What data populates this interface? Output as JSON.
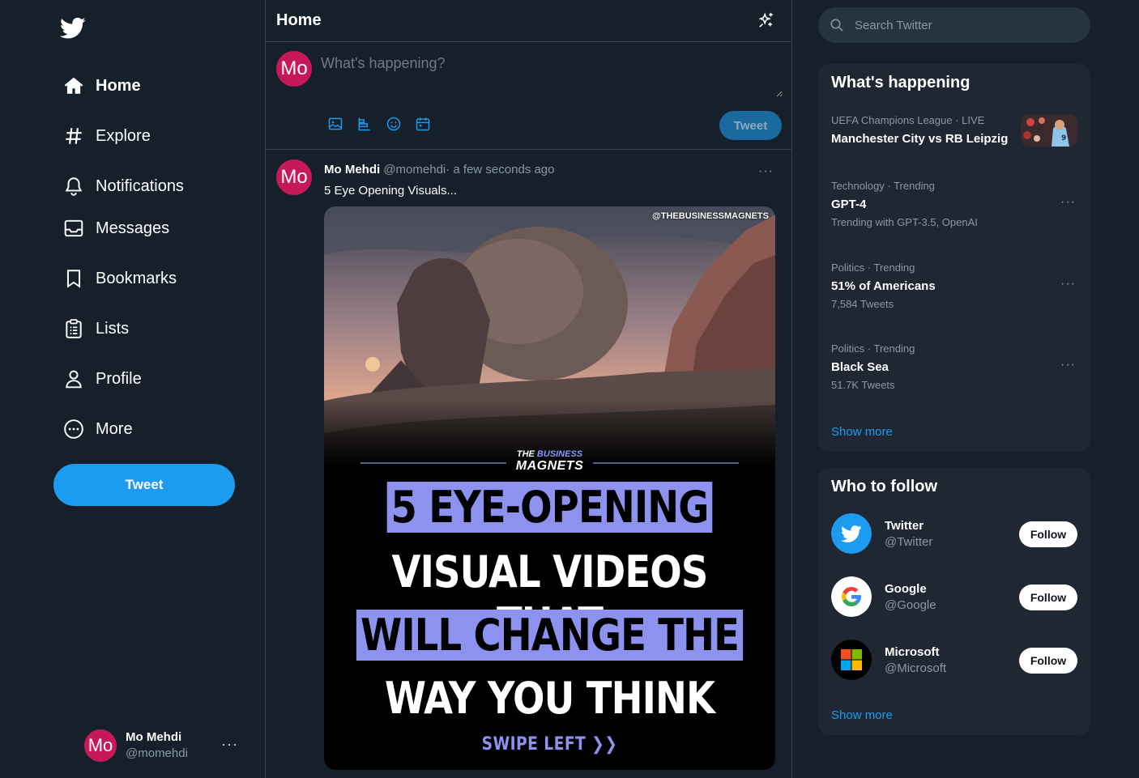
{
  "sidebar": {
    "logo_icon": "twitter-bird-icon",
    "items": [
      {
        "label": "Home",
        "icon": "home-icon"
      },
      {
        "label": "Explore",
        "icon": "hashtag-icon"
      },
      {
        "label": "Notifications",
        "icon": "bell-icon"
      },
      {
        "label": "Messages",
        "icon": "envelope-icon"
      },
      {
        "label": "Bookmarks",
        "icon": "bookmark-icon"
      },
      {
        "label": "Lists",
        "icon": "list-icon"
      },
      {
        "label": "Profile",
        "icon": "person-icon"
      },
      {
        "label": "More",
        "icon": "more-circle-icon"
      }
    ],
    "tweet_button": "Tweet",
    "account": {
      "avatar": "Mo",
      "name": "Mo Mehdi",
      "handle": "@momehdi",
      "more": "···"
    }
  },
  "main": {
    "title": "Home",
    "composer": {
      "avatar": "Mo",
      "placeholder": "What's happening?",
      "tweet_button": "Tweet"
    },
    "tweet": {
      "avatar": "Mo",
      "name": "Mo Mehdi",
      "handle": "@momehdi",
      "time": "· a few seconds ago",
      "text": "5 Eye Opening Visuals...",
      "more": "···",
      "media": {
        "watermark": "@THEBUSINESSMAGNETS",
        "brand_top_1": "THE ",
        "brand_top_2": "BUSINESS",
        "brand_bottom": "MAGNETS",
        "line1": "5 EYE-OPENING",
        "line2": "VISUAL VIDEOS THAT",
        "line3": "WILL CHANGE THE",
        "line4": "WAY YOU THINK",
        "swipe": "SWIPE LEFT ❯❯"
      }
    }
  },
  "right": {
    "search_placeholder": "Search Twitter",
    "happening": {
      "title": "What's happening",
      "trends": [
        {
          "category": "UEFA Champions League · LIVE",
          "title": "Manchester City vs RB Leipzig",
          "sub": ""
        },
        {
          "category": "Technology · Trending",
          "title": "GPT-4",
          "sub": "Trending with GPT-3.5, OpenAI"
        },
        {
          "category": "Politics · Trending",
          "title": "51% of Americans",
          "sub": "7,584 Tweets"
        },
        {
          "category": "Politics · Trending",
          "title": "Black Sea",
          "sub": "51.7K Tweets"
        }
      ],
      "show_more": "Show more"
    },
    "who_to_follow": {
      "title": "Who to follow",
      "accounts": [
        {
          "name": "Twitter",
          "handle": "@Twitter",
          "button": "Follow"
        },
        {
          "name": "Google",
          "handle": "@Google",
          "button": "Follow"
        },
        {
          "name": "Microsoft",
          "handle": "@Microsoft",
          "button": "Follow"
        }
      ],
      "show_more": "Show more"
    }
  },
  "colors": {
    "background": "#15202b",
    "accent": "#1d9bf0",
    "avatar": "#c7195a",
    "panel": "#1e2732",
    "highlight": "#8c92ee"
  }
}
